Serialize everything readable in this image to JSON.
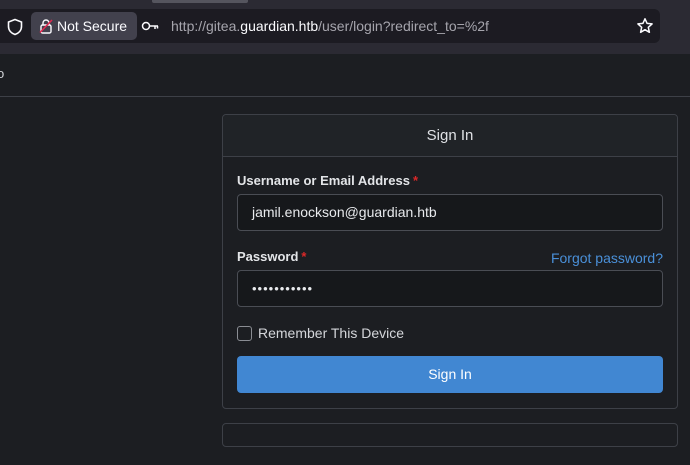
{
  "browser": {
    "security_label": "Not Secure",
    "url_prefix": "http://gitea.",
    "url_host": "guardian.htb",
    "url_path": "/user/login?redirect_to=%2f"
  },
  "header": {
    "fragment": "o"
  },
  "signin": {
    "title": "Sign In",
    "username_label": "Username or Email Address",
    "username_value": "jamil.enockson@guardian.htb",
    "password_label": "Password",
    "password_masked": "•••••••••••",
    "required_marker": "*",
    "forgot_label": "Forgot password?",
    "remember_label": "Remember This Device",
    "remember_checked": false,
    "submit_label": "Sign In"
  },
  "colors": {
    "accent": "#4187d2",
    "link": "#4a90d9",
    "required": "#db2828"
  }
}
